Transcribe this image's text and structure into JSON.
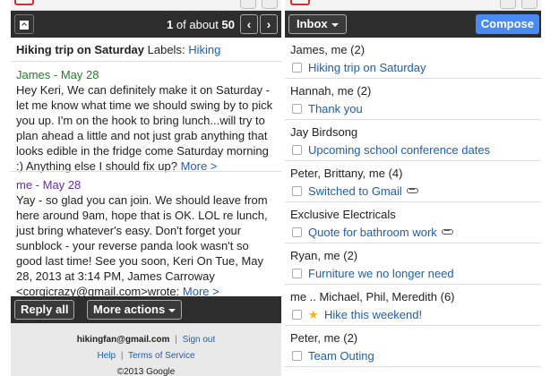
{
  "conversation": {
    "counter_current": "1",
    "counter_of": "of about",
    "counter_total": "50",
    "prev_glyph": "‹",
    "next_glyph": "›",
    "subject": "Hiking trip on Saturday",
    "labels_prefix": "Labels:",
    "label": "Hiking",
    "messages": [
      {
        "sender": "James - May 28",
        "body": "Hey Keri, We can definitely make it on Saturday - let me know what time we should swing by to pick you up. I'm on the hook to bring lunch...will try to plan ahead a little and not just grab anything that looks edible in the fridge come Saturday morning :) Anything else I should fix up?",
        "more": "More >"
      },
      {
        "sender": "me - May 28",
        "body": "Yay - so glad you can join. We should leave from here around 9am, hope that is OK. LOL re lunch, just bring whatever's easy. Don't forget your sunblock - your reverse panda look wasn't so good last time! See you soon, Keri On Tue, May 28, 2013 at 3:14 PM, James Carroway <corgicrazy@gmail.com>wrote:",
        "more": "More >"
      }
    ],
    "reply_all": "Reply all",
    "more_actions": "More actions"
  },
  "footer": {
    "account": "hikingfan@gmail.com",
    "separator": "|",
    "sign_out": "Sign out",
    "help": "Help",
    "terms": "Terms of Service",
    "copyright": "©2013 Google"
  },
  "inbox": {
    "folder": "Inbox",
    "compose": "Compose",
    "threads": [
      {
        "participants": "James, me (2)",
        "subject": "Hiking trip on Saturday",
        "starred": false,
        "attachment": false
      },
      {
        "participants": "Hannah, me (2)",
        "subject": "Thank you",
        "starred": false,
        "attachment": false
      },
      {
        "participants": "Jay Birdsong",
        "subject": "Upcoming school conference dates",
        "starred": false,
        "attachment": false
      },
      {
        "participants": "Peter, Brittany, me (4)",
        "subject": "Switched to Gmail",
        "starred": false,
        "attachment": true
      },
      {
        "participants": "Exclusive Electricals",
        "subject": "Quote for bathroom work",
        "starred": false,
        "attachment": true
      },
      {
        "participants": "Ryan, me (2)",
        "subject": "Furniture we no longer need",
        "starred": false,
        "attachment": false
      },
      {
        "participants": "me .. Michael, Phil, Meredith (6)",
        "subject": "Hike this weekend!",
        "starred": true,
        "attachment": false
      },
      {
        "participants": "Peter, me (2)",
        "subject": "Team Outing",
        "starred": false,
        "attachment": false
      }
    ]
  },
  "colors": {
    "toolbar": "#2d2d2d",
    "link": "#1a5fb4",
    "compose": "#4a8af4",
    "sender_james": "#2a7a2a",
    "sender_me": "#6a2aa8",
    "star": "#f4b400"
  },
  "icons": {
    "archive": "archive-icon",
    "star": "star-icon",
    "attachment": "paperclip-icon",
    "caret": "caret-down-icon"
  }
}
